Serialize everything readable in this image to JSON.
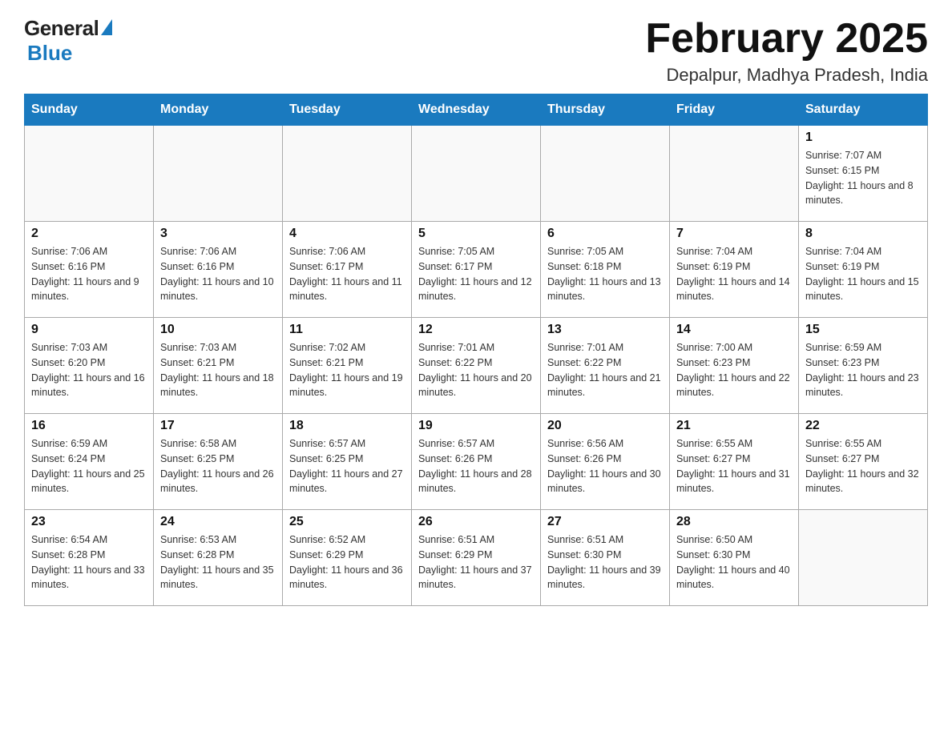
{
  "header": {
    "logo_general": "General",
    "logo_blue": "Blue",
    "month_year": "February 2025",
    "location": "Depalpur, Madhya Pradesh, India"
  },
  "weekdays": [
    "Sunday",
    "Monday",
    "Tuesday",
    "Wednesday",
    "Thursday",
    "Friday",
    "Saturday"
  ],
  "weeks": [
    [
      {
        "day": "",
        "info": ""
      },
      {
        "day": "",
        "info": ""
      },
      {
        "day": "",
        "info": ""
      },
      {
        "day": "",
        "info": ""
      },
      {
        "day": "",
        "info": ""
      },
      {
        "day": "",
        "info": ""
      },
      {
        "day": "1",
        "info": "Sunrise: 7:07 AM\nSunset: 6:15 PM\nDaylight: 11 hours and 8 minutes."
      }
    ],
    [
      {
        "day": "2",
        "info": "Sunrise: 7:06 AM\nSunset: 6:16 PM\nDaylight: 11 hours and 9 minutes."
      },
      {
        "day": "3",
        "info": "Sunrise: 7:06 AM\nSunset: 6:16 PM\nDaylight: 11 hours and 10 minutes."
      },
      {
        "day": "4",
        "info": "Sunrise: 7:06 AM\nSunset: 6:17 PM\nDaylight: 11 hours and 11 minutes."
      },
      {
        "day": "5",
        "info": "Sunrise: 7:05 AM\nSunset: 6:17 PM\nDaylight: 11 hours and 12 minutes."
      },
      {
        "day": "6",
        "info": "Sunrise: 7:05 AM\nSunset: 6:18 PM\nDaylight: 11 hours and 13 minutes."
      },
      {
        "day": "7",
        "info": "Sunrise: 7:04 AM\nSunset: 6:19 PM\nDaylight: 11 hours and 14 minutes."
      },
      {
        "day": "8",
        "info": "Sunrise: 7:04 AM\nSunset: 6:19 PM\nDaylight: 11 hours and 15 minutes."
      }
    ],
    [
      {
        "day": "9",
        "info": "Sunrise: 7:03 AM\nSunset: 6:20 PM\nDaylight: 11 hours and 16 minutes."
      },
      {
        "day": "10",
        "info": "Sunrise: 7:03 AM\nSunset: 6:21 PM\nDaylight: 11 hours and 18 minutes."
      },
      {
        "day": "11",
        "info": "Sunrise: 7:02 AM\nSunset: 6:21 PM\nDaylight: 11 hours and 19 minutes."
      },
      {
        "day": "12",
        "info": "Sunrise: 7:01 AM\nSunset: 6:22 PM\nDaylight: 11 hours and 20 minutes."
      },
      {
        "day": "13",
        "info": "Sunrise: 7:01 AM\nSunset: 6:22 PM\nDaylight: 11 hours and 21 minutes."
      },
      {
        "day": "14",
        "info": "Sunrise: 7:00 AM\nSunset: 6:23 PM\nDaylight: 11 hours and 22 minutes."
      },
      {
        "day": "15",
        "info": "Sunrise: 6:59 AM\nSunset: 6:23 PM\nDaylight: 11 hours and 23 minutes."
      }
    ],
    [
      {
        "day": "16",
        "info": "Sunrise: 6:59 AM\nSunset: 6:24 PM\nDaylight: 11 hours and 25 minutes."
      },
      {
        "day": "17",
        "info": "Sunrise: 6:58 AM\nSunset: 6:25 PM\nDaylight: 11 hours and 26 minutes."
      },
      {
        "day": "18",
        "info": "Sunrise: 6:57 AM\nSunset: 6:25 PM\nDaylight: 11 hours and 27 minutes."
      },
      {
        "day": "19",
        "info": "Sunrise: 6:57 AM\nSunset: 6:26 PM\nDaylight: 11 hours and 28 minutes."
      },
      {
        "day": "20",
        "info": "Sunrise: 6:56 AM\nSunset: 6:26 PM\nDaylight: 11 hours and 30 minutes."
      },
      {
        "day": "21",
        "info": "Sunrise: 6:55 AM\nSunset: 6:27 PM\nDaylight: 11 hours and 31 minutes."
      },
      {
        "day": "22",
        "info": "Sunrise: 6:55 AM\nSunset: 6:27 PM\nDaylight: 11 hours and 32 minutes."
      }
    ],
    [
      {
        "day": "23",
        "info": "Sunrise: 6:54 AM\nSunset: 6:28 PM\nDaylight: 11 hours and 33 minutes."
      },
      {
        "day": "24",
        "info": "Sunrise: 6:53 AM\nSunset: 6:28 PM\nDaylight: 11 hours and 35 minutes."
      },
      {
        "day": "25",
        "info": "Sunrise: 6:52 AM\nSunset: 6:29 PM\nDaylight: 11 hours and 36 minutes."
      },
      {
        "day": "26",
        "info": "Sunrise: 6:51 AM\nSunset: 6:29 PM\nDaylight: 11 hours and 37 minutes."
      },
      {
        "day": "27",
        "info": "Sunrise: 6:51 AM\nSunset: 6:30 PM\nDaylight: 11 hours and 39 minutes."
      },
      {
        "day": "28",
        "info": "Sunrise: 6:50 AM\nSunset: 6:30 PM\nDaylight: 11 hours and 40 minutes."
      },
      {
        "day": "",
        "info": ""
      }
    ]
  ]
}
